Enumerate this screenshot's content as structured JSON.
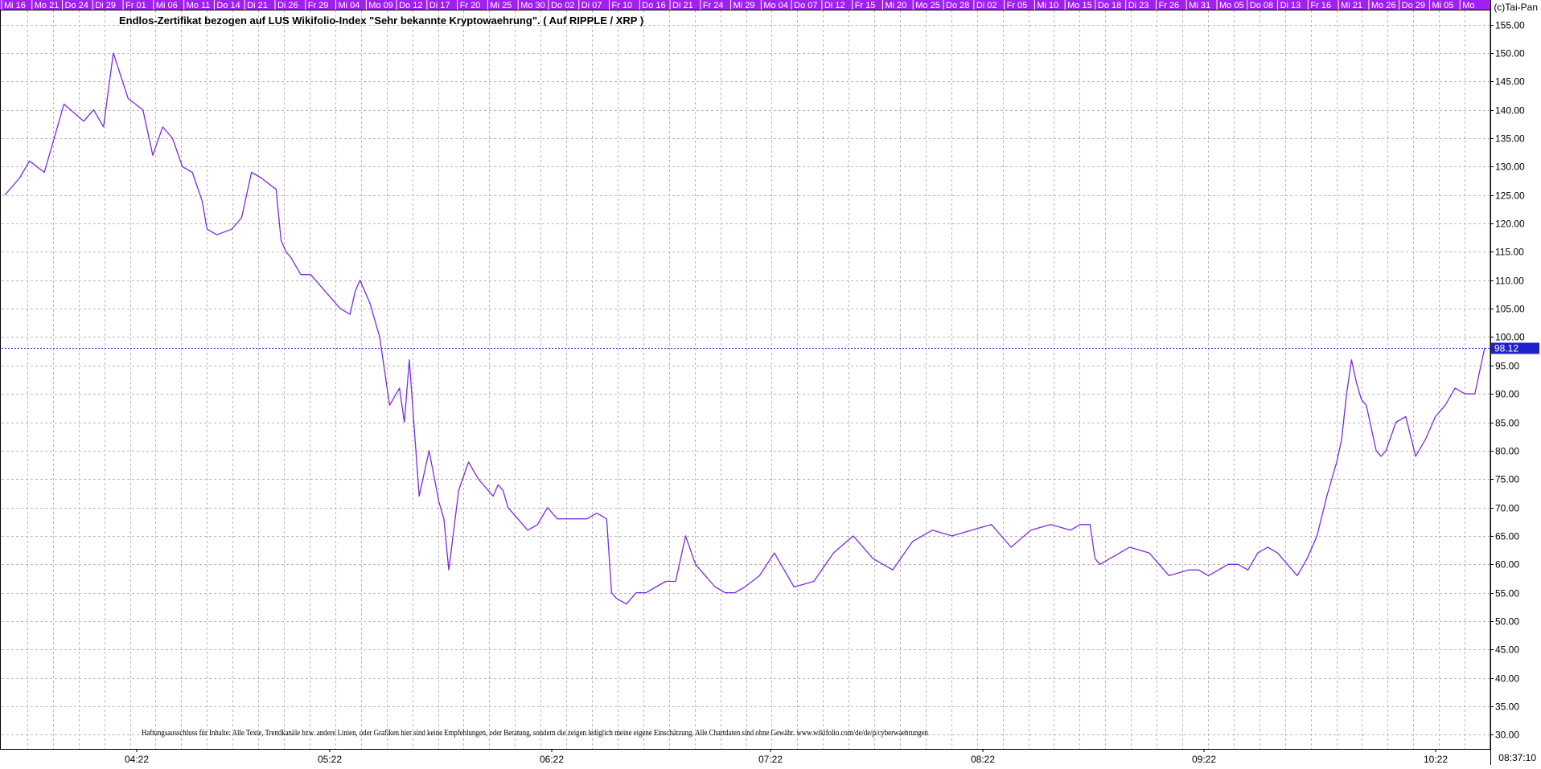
{
  "copyright": "(c)Tai-Pan",
  "time_readout": "08:37:10",
  "disclaimer": "Haftungsausschluss für Inhalte: Alle Texte, Trendkanäle bzw. andere Linien, oder Grafiken hier sind keine Empfehlungen, oder Beratung, sondern die zeigen lediglich meine eigene Einschätzung. Alle Chartdaten sind ohne Gewähr. www.wikifolio.com/de/de/p/cyberwaehrungen",
  "colors": {
    "line": "#7b2be0",
    "last_price_line": "#2b2bdd",
    "last_price_box": "#2222cc",
    "date_strip": "#a020f0",
    "grid": "#b8b8b8",
    "frame": "#000000"
  },
  "chart_data": {
    "type": "line",
    "title": "Endlos-Zertifikat bezogen auf LUS Wikifolio-Index \"Sehr bekannte Kryptowaehrung\". ( Auf RIPPLE / XRP )",
    "ylim": [
      27.5,
      157.5
    ],
    "y_ticks": [
      "30.00",
      "35.00",
      "40.00",
      "45.00",
      "50.00",
      "55.00",
      "60.00",
      "65.00",
      "70.00",
      "75.00",
      "80.00",
      "85.00",
      "90.00",
      "95.00",
      "100.00",
      "105.00",
      "110.00",
      "115.00",
      "120.00",
      "125.00",
      "130.00",
      "135.00",
      "140.00",
      "145.00",
      "150.00",
      "155.00"
    ],
    "month_labels": [
      "04:22",
      "05:22",
      "06:22",
      "07:22",
      "08:22",
      "09:22",
      "10:22"
    ],
    "date_labels": [
      "Mi 16",
      "Mo 21",
      "Do 24",
      "Di 29",
      "Fr 01",
      "Mi 06",
      "Mo 11",
      "Do 14",
      "Di 21",
      "Di 26",
      "Fr 29",
      "Mi 04",
      "Mo 09",
      "Do 12",
      "Di 17",
      "Fr 20",
      "Mi 25",
      "Mo 30",
      "Do 02",
      "Di 07",
      "Fr 10",
      "Do 16",
      "Di 21",
      "Fr 24",
      "Mi 29",
      "Mo 04",
      "Do 07",
      "Di 12",
      "Fr 15",
      "Mi 20",
      "Mo 25",
      "Do 28",
      "Di 02",
      "Fr 05",
      "Mi 10",
      "Mo 15",
      "Do 18",
      "Di 23",
      "Fr 26",
      "Mi 31",
      "Mo 05",
      "Do 08",
      "Di 13",
      "Fr 16",
      "Mi 21",
      "Mo 26",
      "Do 29",
      "Mi 05",
      "Mo"
    ],
    "last_value": 98.12,
    "last_value_label": "98.12",
    "grid": true,
    "x_range": [
      0,
      300
    ],
    "series": [
      {
        "x": [
          0,
          3,
          5,
          8,
          12,
          16,
          18,
          20,
          22,
          25,
          28,
          30,
          32,
          33,
          34,
          36,
          38,
          40,
          41,
          43,
          46,
          48,
          50,
          52,
          55,
          56,
          57,
          58,
          60,
          62,
          65,
          68,
          70,
          71,
          72,
          74,
          76,
          78,
          80,
          81,
          82,
          84,
          86,
          88,
          89,
          90,
          92,
          94,
          96,
          98,
          99,
          100,
          101,
          102,
          104,
          105,
          106,
          108,
          110,
          112,
          114,
          116,
          118,
          120,
          122,
          123,
          124,
          126,
          128,
          130,
          132,
          134,
          136,
          138,
          140,
          142,
          144,
          146,
          148,
          150,
          153,
          156,
          160,
          164,
          168,
          172,
          176,
          180,
          184,
          188,
          192,
          196,
          200,
          204,
          208,
          212,
          216,
          218,
          220,
          221,
          222,
          224,
          228,
          232,
          236,
          240,
          242,
          244,
          246,
          248,
          250,
          252,
          254,
          256,
          258,
          260,
          262,
          264,
          266,
          268,
          270,
          271,
          272,
          273,
          274,
          275,
          276,
          278,
          279,
          280,
          282,
          284,
          286,
          288,
          290,
          292,
          294,
          296,
          298,
          300
        ],
        "y": [
          125,
          128,
          131,
          129,
          141,
          138,
          140,
          137,
          150,
          142,
          140,
          132,
          137,
          136,
          135,
          130,
          129,
          124,
          119,
          118,
          119,
          121,
          129,
          128,
          126,
          117,
          115,
          114,
          111,
          111,
          108,
          105,
          104,
          108,
          110,
          106,
          100,
          88,
          91,
          85,
          96,
          72,
          80,
          71,
          68,
          59,
          73,
          78,
          75,
          73,
          72,
          74,
          73,
          70,
          68,
          67,
          66,
          67,
          70,
          68,
          68,
          68,
          68,
          69,
          68,
          55,
          54,
          53,
          55,
          55,
          56,
          57,
          57,
          65,
          60,
          58,
          56,
          55,
          55,
          56,
          58,
          62,
          56,
          57,
          62,
          65,
          61,
          59,
          64,
          66,
          65,
          66,
          67,
          63,
          66,
          67,
          66,
          67,
          67,
          61,
          60,
          61,
          63,
          62,
          58,
          59,
          59,
          58,
          59,
          60,
          60,
          59,
          62,
          63,
          62,
          60,
          58,
          61,
          65,
          72,
          78,
          82,
          90,
          96,
          92,
          89,
          88,
          80,
          79,
          80,
          85,
          86,
          79,
          82,
          86,
          88,
          91,
          90,
          90,
          98.12
        ]
      }
    ]
  }
}
